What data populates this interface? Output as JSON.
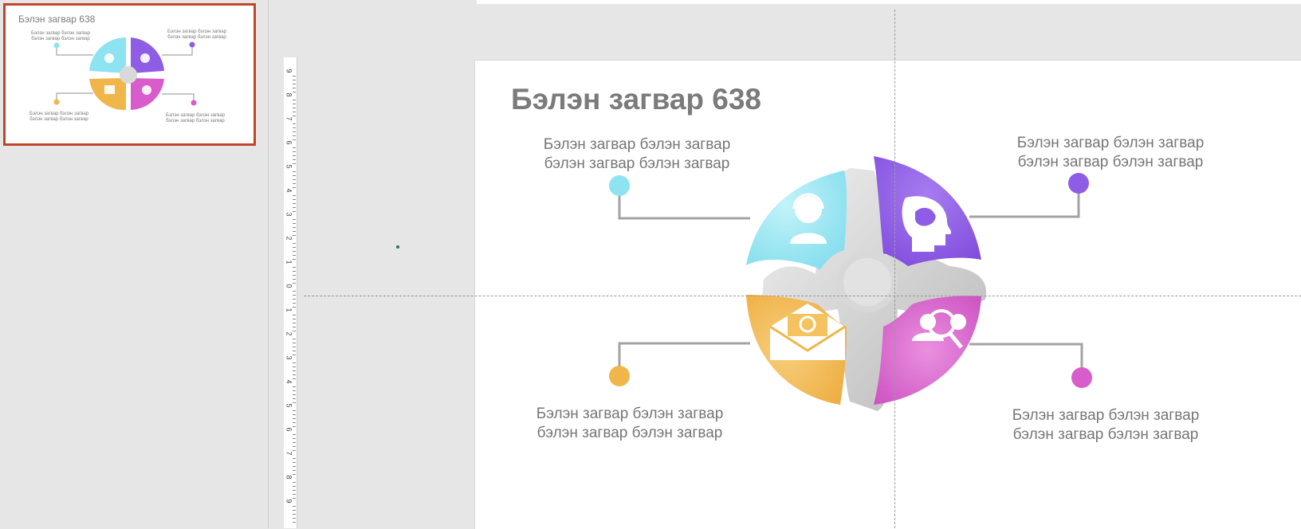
{
  "thumbnail": {
    "title": "Бэлэн загвар 638",
    "text_top_left_1": "Бэлэн загвар бэлэн загвар",
    "text_top_left_2": "бэлэн загвар бэлэн загвар",
    "text_top_right_1": "Бэлэн загвар бэлэн загвар",
    "text_top_right_2": "бэлэн загвар бэлэн загвар",
    "text_bottom_left_1": "Бэлэн загвар бэлэн загвар",
    "text_bottom_left_2": "бэлэн загвар бэлэн загвар",
    "text_bottom_right_1": "Бэлэн загвар бэлэн загвар",
    "text_bottom_right_2": "бэлэн загвар бэлэн загвар"
  },
  "ruler": {
    "labels": [
      "9",
      "8",
      "7",
      "6",
      "5",
      "4",
      "3",
      "2",
      "1",
      "0",
      "1",
      "2",
      "3",
      "4",
      "5",
      "6",
      "7",
      "8",
      "9"
    ]
  },
  "slide": {
    "title": "Бэлэн загвар 638",
    "quadrants": {
      "top_left": {
        "line1": "Бэлэн загвар бэлэн загвар",
        "line2": "бэлэн загвар бэлэн загвар",
        "color": "#8ee3f1",
        "icon": "support-agent-icon"
      },
      "top_right": {
        "line1": "Бэлэн загвар бэлэн загвар",
        "line2": "бэлэн загвар бэлэн загвар",
        "color": "#8f5ce6",
        "icon": "brain-head-icon"
      },
      "bottom_left": {
        "line1": "Бэлэн загвар бэлэн загвар",
        "line2": "бэлэн загвар бэлэн загвар",
        "color": "#f1b64a",
        "icon": "email-envelope-icon"
      },
      "bottom_right": {
        "line1": "Бэлэн загвар бэлэн загвар",
        "line2": "бэлэн загвар бэлэн загвар",
        "color": "#d85ccb",
        "icon": "team-search-icon"
      }
    }
  },
  "colors": {
    "thumbnail_selection": "#c0462b",
    "title_gray": "#7b7b7b",
    "connector_gray": "#a3a3a3"
  }
}
